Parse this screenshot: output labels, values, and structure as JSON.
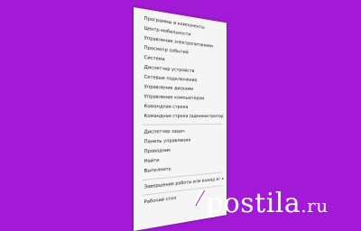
{
  "background_color": "#a21ad6",
  "menu": {
    "items": [
      "Программы и компоненты",
      "Центр мобильности",
      "Управление электропитанием",
      "Просмотр событий",
      "Система",
      "Диспетчер устройств",
      "Сетевые подключения",
      "Управление дисками",
      "Управление компьютером",
      "Командная строка",
      "Командная строка (администратор)",
      "Диспетчер задач",
      "Панель управления",
      "Проводник",
      "Найти",
      "Выполнить",
      "Завершение работы или выход из системы",
      "Рабочий стол"
    ],
    "submenu_arrow": "▸"
  },
  "watermark": {
    "name": "postila",
    "tld": ".ru",
    "icon": "leaf-logo-icon"
  }
}
